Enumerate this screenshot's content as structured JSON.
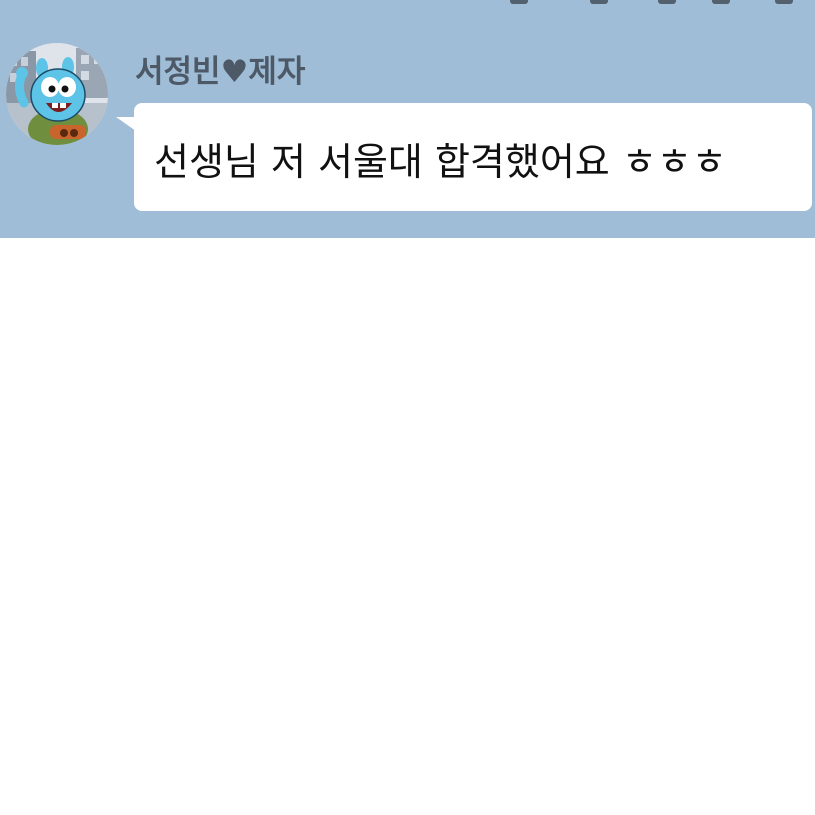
{
  "chat": {
    "background_color": "#9fbdd6",
    "message": {
      "sender_name": "서정빈♥제자",
      "avatar_icon": "gumball-cartoon-avatar-icon",
      "text": "선생님 저 서울대 합격했어요 ㅎㅎㅎ",
      "bubble_color": "#ffffff"
    }
  }
}
